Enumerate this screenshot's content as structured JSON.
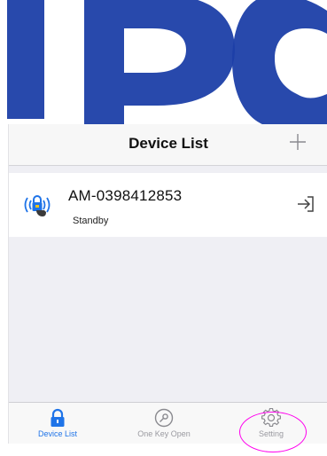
{
  "colors": {
    "watermark": "#1c3fa8",
    "accent": "#1f74e8",
    "tab_inactive": "#9a9aa0",
    "background": "#efeff4",
    "annotation": "#ff00ee"
  },
  "watermark": {
    "text": "IPC"
  },
  "nav": {
    "title": "Device List",
    "add_icon": "plus-icon"
  },
  "devices": [
    {
      "name": "AM-0398412853",
      "status": "Standby",
      "icon": "wireless-lock-icon",
      "action_icon": "enter-arrow-icon"
    }
  ],
  "tabs": [
    {
      "label": "Device List",
      "icon": "lock-icon",
      "active": true
    },
    {
      "label": "One Key Open",
      "icon": "key-circle-icon",
      "active": false
    },
    {
      "label": "Setting",
      "icon": "gear-icon",
      "active": false
    }
  ]
}
